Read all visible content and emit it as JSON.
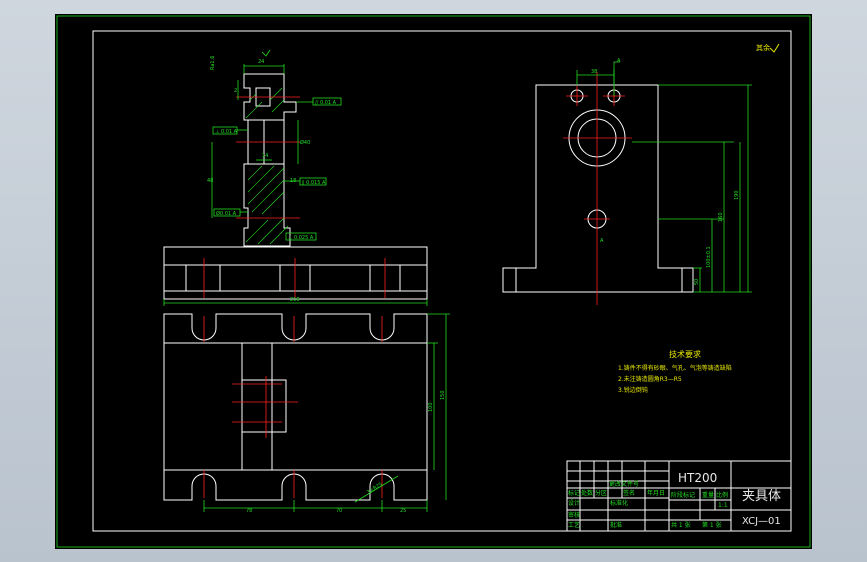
{
  "colors": {
    "paper": "#000000",
    "frame": "#22dd22",
    "geometry": "#ffffff",
    "center_lines": "#ff2020",
    "dimensions": "#22dd22",
    "background": "#c2cbd5"
  },
  "front_view": {
    "dimensions": {
      "top_width": "24",
      "hole_spacing": "14",
      "side_height": "48",
      "mid_dia": "Ø40",
      "base_length": "216",
      "small_dim": "2",
      "ref_18": "18"
    },
    "tolerance_frames": [
      "// 0.01 A",
      "⊥ 0.01 A",
      "∥ 0.015 A",
      "Ø0.01 A",
      "⊥ 0.025 A"
    ],
    "surface_mark": "Ra1.6"
  },
  "side_view": {
    "dimensions": {
      "top_hole": "38",
      "h1": "50",
      "h2": "100±0.1",
      "h3": "160",
      "h4": "190"
    },
    "datum": "A"
  },
  "plan_view": {
    "dimensions": {
      "w1": "78",
      "w2": "70",
      "w3": "25",
      "v1": "100",
      "v2": "150"
    },
    "slot_callout": "3×R25"
  },
  "tech_requirements": {
    "title": "技术要求",
    "items": [
      "1.铸件不得有砂眼、气孔、气泡等铸造缺陷",
      "2.未注铸造圆角R3—R5",
      "3.锐边倒钝"
    ]
  },
  "roughness_note": "其余",
  "title_block": {
    "material": "HT200",
    "part_name": "夹具体",
    "drawing_no": "XCJ—01",
    "labels": [
      "标记",
      "处数",
      "分区",
      "更改文件号",
      "签名",
      "年月日",
      "设计",
      "审核",
      "工艺",
      "标准化",
      "批准"
    ],
    "stage_label": "阶段标记",
    "weight_label": "重量",
    "scale_label": "比例",
    "scale": "1:1",
    "sheets": "共 1 张",
    "sheet": "第 1 张"
  }
}
